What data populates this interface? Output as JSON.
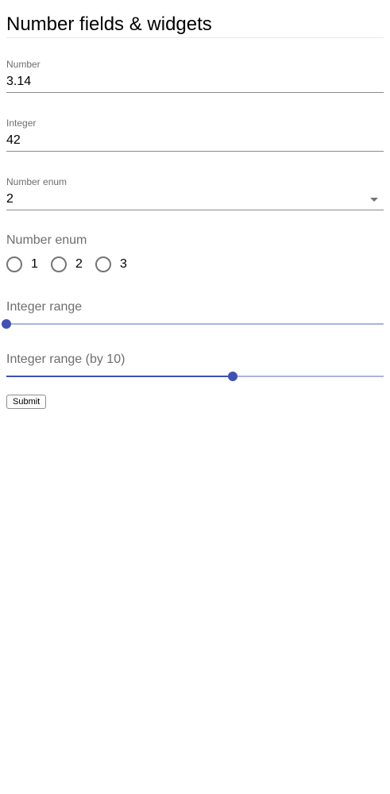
{
  "page": {
    "title": "Number fields & widgets"
  },
  "fields": {
    "number": {
      "label": "Number",
      "value": "3.14"
    },
    "integer": {
      "label": "Integer",
      "value": "42"
    },
    "number_enum_select": {
      "label": "Number enum",
      "value": "2"
    },
    "number_enum_radio": {
      "label": "Number enum",
      "options": [
        "1",
        "2",
        "3"
      ],
      "selected": null
    },
    "integer_range": {
      "label": "Integer range",
      "fraction": 0
    },
    "integer_range_by_10": {
      "label": "Integer range (by 10)",
      "fraction": 0.6
    }
  },
  "actions": {
    "submit_label": "Submit"
  },
  "colors": {
    "accent": "#3f51b5",
    "rail": "#aab4de",
    "label": "#6e6e6e",
    "underline": "#8a8a8a"
  }
}
